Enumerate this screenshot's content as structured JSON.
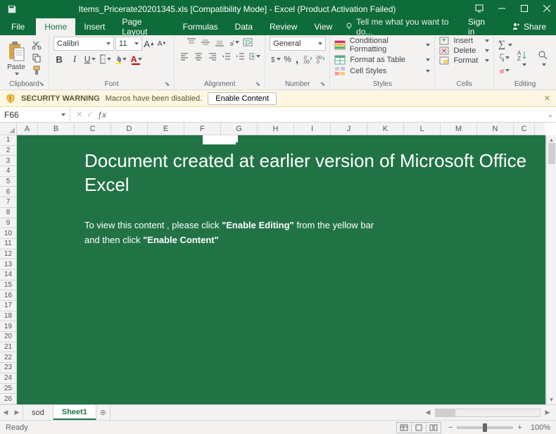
{
  "title": "Items_Pricerate20201345.xls  [Compatibility Mode] - Excel (Product Activation Failed)",
  "menubar": {
    "file": "File",
    "home": "Home",
    "insert": "Insert",
    "page": "Page Layout",
    "formulas": "Formulas",
    "data": "Data",
    "review": "Review",
    "view": "View",
    "tellme": "Tell me what you want to do...",
    "signin": "Sign in",
    "share": "Share"
  },
  "ribbon": {
    "clipboard": {
      "paste": "Paste",
      "label": "Clipboard"
    },
    "font": {
      "name": "Calibri",
      "size": "11",
      "label": "Font"
    },
    "alignment": {
      "label": "Alignment"
    },
    "number": {
      "format": "General",
      "label": "Number"
    },
    "styles": {
      "cond": "Conditional Formatting",
      "table": "Format as Table",
      "cell": "Cell Styles",
      "label": "Styles"
    },
    "cells": {
      "insert": "Insert",
      "delete": "Delete",
      "format": "Format",
      "label": "Cells"
    },
    "editing": {
      "label": "Editing"
    }
  },
  "warning": {
    "label": "SECURITY WARNING",
    "msg": "Macros have been disabled.",
    "button": "Enable Content"
  },
  "namebox": "F66",
  "columns": [
    "A",
    "B",
    "C",
    "D",
    "E",
    "F",
    "G",
    "H",
    "I",
    "J",
    "K",
    "L",
    "M",
    "N",
    "C"
  ],
  "rows_start": 1,
  "rows_end": 26,
  "doc": {
    "h1": "Document created at earlier version of Microsoft Office Excel",
    "l1a": "To view this content , please click   ",
    "l1b": "\"Enable Editing\"",
    "l1c": "   from the yellow bar",
    "l2a": "and then click   ",
    "l2b": "\"Enable Content\""
  },
  "tabs": {
    "sod": "sod",
    "sheet1": "Sheet1"
  },
  "status": {
    "ready": "Ready",
    "zoom": "100%"
  }
}
